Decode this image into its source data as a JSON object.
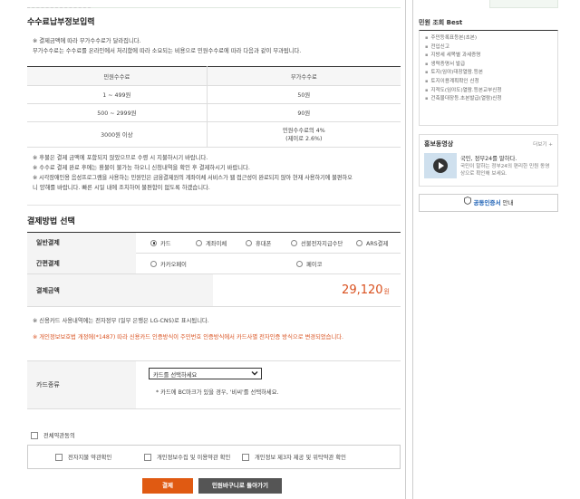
{
  "fee_section": {
    "title": "수수료납부정보입력",
    "notes": [
      "※ 결제금액에 따라 부가수수료가 달라집니다.",
      "부가수수료는 수수료를 온라인에서 처리함에 따라 소요되는 비용으로 민원수수료에 따라 다음과 같이 부과됩니다."
    ],
    "table": {
      "headers": [
        "민원수수료",
        "부가수수료"
      ],
      "rows": [
        {
          "range": "1 ~ 499원",
          "fee": "50원"
        },
        {
          "range": "500 ~ 2999원",
          "fee": "90원"
        },
        {
          "range": "3000원 이상",
          "fee": "민원수수료의 4%",
          "fee_sub": "(제이로 2.6%)"
        }
      ]
    },
    "warnings": [
      "※ 후불은 결제 금액에 포함되지 않았으므로 수령 시 지불하시기 바랍니다.",
      "※ 수수료 결제 완료 후에는 환불이 불가능 하오니 신청내역을 확인 후 결제하시기 바랍니다.",
      "※ 시각장애인용 음성프로그램을 사용하는 민원인은 금융결제원의 계좌이체 서비스가 웹 접근성이 완료되지 않아 현재 사용하기에 불편하오",
      "니 양해를 바랍니다. 빠른 시일 내에 조치하여 불편함이 없도록 하겠습니다."
    ]
  },
  "payment": {
    "title": "결제방법 선택",
    "general_label": "일반결제",
    "general_options": [
      "카드",
      "계좌이체",
      "휴대폰",
      "선불전자지급수단",
      "ARS결제"
    ],
    "simple_label": "간편결제",
    "simple_options": [
      "카카오페이",
      "페이코"
    ],
    "amount_label": "결제금액",
    "amount": "29,120",
    "amount_unit": "원"
  },
  "card": {
    "note": "※ 신용카드 사용내역에는 전자정부 (일부 은행은 LG-CNS)로 표시됩니다.",
    "red_note": "※ 개인정보보호법 개정에(*1487) 따라 신용카드 인증방식이 주민번호 인증방식에서 카드사별 전자인증 방식으로 변경되었습니다.",
    "label": "카드종류",
    "select_value": "카드를 선택하세요",
    "hint": "* 카드에 BC마크가 있을 경우, '비씨'를 선택하세요."
  },
  "agreements": {
    "all": "전체약관동의",
    "items": [
      "전자지불 약관확인",
      "개인정보수집 및 이용약관 확인",
      "개인정보 제3자 제공 및 위탁약관 확인"
    ]
  },
  "buttons": {
    "pay": "결제",
    "back": "민원바구니로 돌아가기"
  },
  "sidebar": {
    "best_title": "민원 조회 Best",
    "best_items": [
      "주민등록표등본(초본)",
      "전입신고",
      "지방세 세목별 과세증명",
      "생력증명서 발급",
      "토지(임야)대장열람.등본",
      "토지이용계획확인 신청",
      "지적도(임야도)열람.등본교부신청",
      "건축물대장등.초본발급(열람)신청"
    ],
    "video_title": "홍보동영상",
    "more": "더보기 +",
    "video_heading": "국민, 정부24를 말하다.",
    "video_desc": "국민이 말하는 정부24의 편리한 민원 동영상으로 확인해 보세요.",
    "cert_label": "공동인증서",
    "cert_suffix": " 안내"
  },
  "colors": {
    "accent": "#d9501e",
    "pay_button": "#e05a12",
    "back_button": "#555555"
  }
}
